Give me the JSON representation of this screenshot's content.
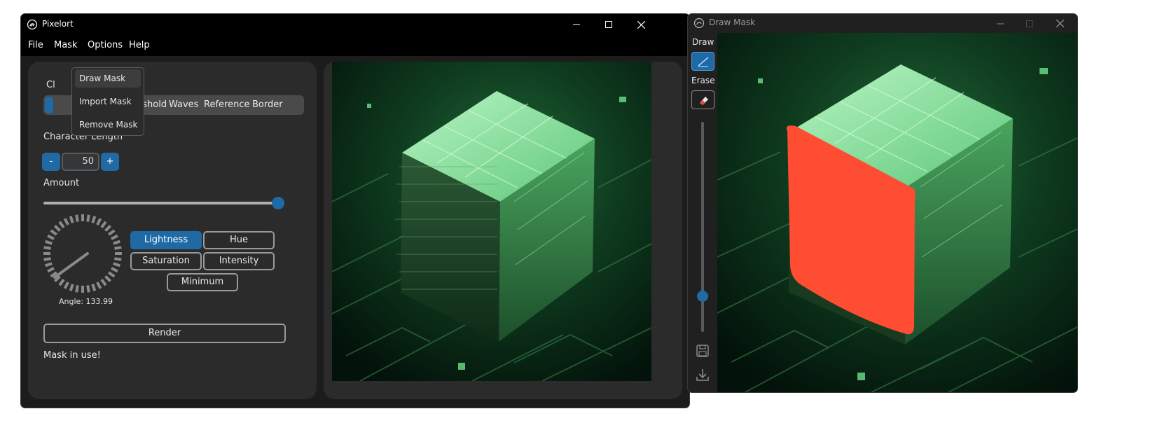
{
  "app": {
    "title": "Pixelort",
    "menu": [
      "File",
      "Mask",
      "Options",
      "Help"
    ],
    "mask_menu": [
      "Draw Mask",
      "Import Mask",
      "Remove Mask"
    ],
    "tabs_visible_partial": "Cl",
    "tabs": [
      "Threshold",
      "Waves",
      "Reference",
      "Border"
    ],
    "char_length_label": "Character Length",
    "minus_label": "-",
    "plus_label": "+",
    "char_length_value": "50",
    "amount_label": "Amount",
    "amount_fraction": 0.96,
    "angle_label": "Angle: 133.99",
    "angle_value": 133.99,
    "sort_modes": [
      {
        "label": "Lightness",
        "active": true
      },
      {
        "label": "Hue",
        "active": false
      },
      {
        "label": "Saturation",
        "active": false
      },
      {
        "label": "Intensity",
        "active": false
      },
      {
        "label": "Minimum",
        "active": false
      }
    ],
    "render_label": "Render",
    "status": "Mask in use!"
  },
  "mask_window": {
    "title": "Draw Mask",
    "draw_label": "Draw",
    "erase_label": "Erase",
    "brush_size_fraction": 0.17,
    "mask_color": "#ff4d33"
  },
  "colors": {
    "accent": "#1f6aa5",
    "window_bg": "#1c1c1c",
    "panel_bg": "#2b2b2b",
    "mask": "#ff4d33"
  }
}
